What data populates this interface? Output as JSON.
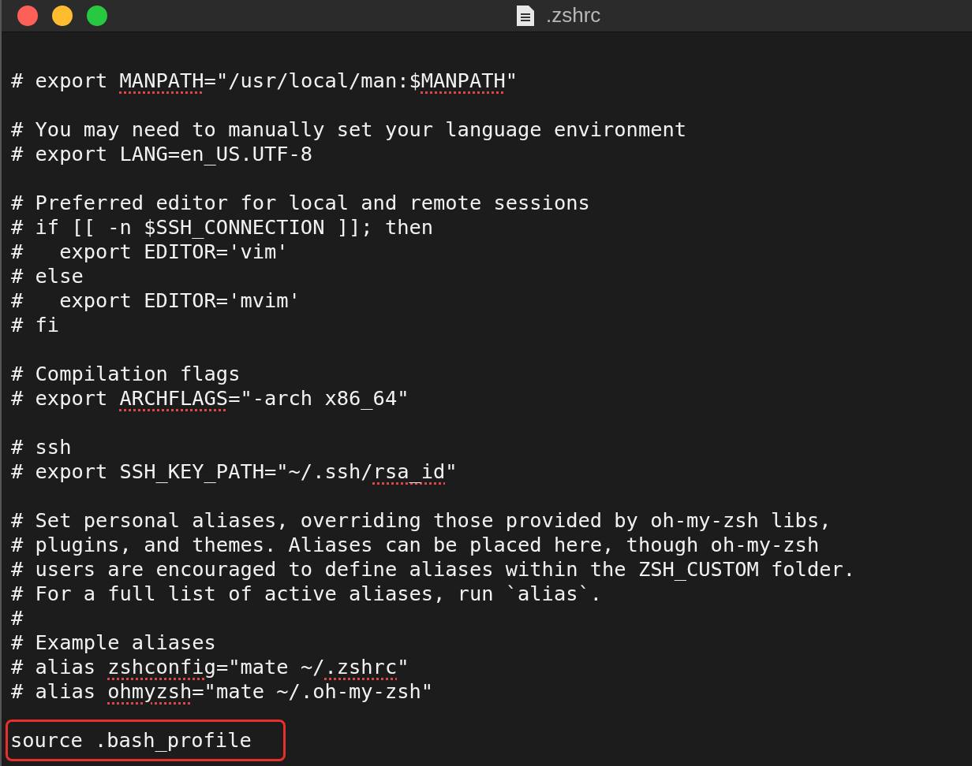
{
  "window": {
    "title": ".zshrc"
  },
  "lines": [
    {
      "kind": "blank"
    },
    {
      "kind": "text",
      "highlighted": false,
      "segments": [
        {
          "text": "# export ",
          "misspelled": false
        },
        {
          "text": "MANPATH",
          "misspelled": true
        },
        {
          "text": "=\"/usr/local/man:$",
          "misspelled": false
        },
        {
          "text": "MANPATH",
          "misspelled": true
        },
        {
          "text": "\"",
          "misspelled": false
        }
      ]
    },
    {
      "kind": "blank"
    },
    {
      "kind": "text",
      "highlighted": false,
      "segments": [
        {
          "text": "# You may need to manually set your language environment",
          "misspelled": false
        }
      ]
    },
    {
      "kind": "text",
      "highlighted": false,
      "segments": [
        {
          "text": "# export LANG=en_US.UTF-8",
          "misspelled": false
        }
      ]
    },
    {
      "kind": "blank"
    },
    {
      "kind": "text",
      "highlighted": false,
      "segments": [
        {
          "text": "# Preferred editor for local and remote sessions",
          "misspelled": false
        }
      ]
    },
    {
      "kind": "text",
      "highlighted": false,
      "segments": [
        {
          "text": "# if [[ -n $SSH_CONNECTION ]]; then",
          "misspelled": false
        }
      ]
    },
    {
      "kind": "text",
      "highlighted": false,
      "segments": [
        {
          "text": "#   export EDITOR='vim'",
          "misspelled": false
        }
      ]
    },
    {
      "kind": "text",
      "highlighted": false,
      "segments": [
        {
          "text": "# else",
          "misspelled": false
        }
      ]
    },
    {
      "kind": "text",
      "highlighted": false,
      "segments": [
        {
          "text": "#   export EDITOR='mvim'",
          "misspelled": false
        }
      ]
    },
    {
      "kind": "text",
      "highlighted": false,
      "segments": [
        {
          "text": "# fi",
          "misspelled": false
        }
      ]
    },
    {
      "kind": "blank"
    },
    {
      "kind": "text",
      "highlighted": false,
      "segments": [
        {
          "text": "# Compilation flags",
          "misspelled": false
        }
      ]
    },
    {
      "kind": "text",
      "highlighted": false,
      "segments": [
        {
          "text": "# export ",
          "misspelled": false
        },
        {
          "text": "ARCHFLAGS",
          "misspelled": true
        },
        {
          "text": "=\"-arch x86_64\"",
          "misspelled": false
        }
      ]
    },
    {
      "kind": "blank"
    },
    {
      "kind": "text",
      "highlighted": false,
      "segments": [
        {
          "text": "# ssh",
          "misspelled": false
        }
      ]
    },
    {
      "kind": "text",
      "highlighted": false,
      "segments": [
        {
          "text": "# export SSH_KEY_PATH=\"~/.ssh/",
          "misspelled": false
        },
        {
          "text": "rsa_id",
          "misspelled": true
        },
        {
          "text": "\"",
          "misspelled": false
        }
      ]
    },
    {
      "kind": "blank"
    },
    {
      "kind": "text",
      "highlighted": false,
      "segments": [
        {
          "text": "# Set personal aliases, overriding those provided by oh-my-zsh libs,",
          "misspelled": false
        }
      ]
    },
    {
      "kind": "text",
      "highlighted": false,
      "segments": [
        {
          "text": "# plugins, and themes. Aliases can be placed here, though oh-my-zsh",
          "misspelled": false
        }
      ]
    },
    {
      "kind": "text",
      "highlighted": false,
      "segments": [
        {
          "text": "# users are encouraged to define aliases within the ZSH_CUSTOM folder.",
          "misspelled": false
        }
      ]
    },
    {
      "kind": "text",
      "highlighted": false,
      "segments": [
        {
          "text": "# For a full list of active aliases, run `alias`.",
          "misspelled": false
        }
      ]
    },
    {
      "kind": "text",
      "highlighted": false,
      "segments": [
        {
          "text": "#",
          "misspelled": false
        }
      ]
    },
    {
      "kind": "text",
      "highlighted": false,
      "segments": [
        {
          "text": "# Example aliases",
          "misspelled": false
        }
      ]
    },
    {
      "kind": "text",
      "highlighted": false,
      "segments": [
        {
          "text": "# alias ",
          "misspelled": false
        },
        {
          "text": "zshconfig",
          "misspelled": true
        },
        {
          "text": "=\"mate ~/",
          "misspelled": false
        },
        {
          "text": ".zshrc",
          "misspelled": true
        },
        {
          "text": "\"",
          "misspelled": false
        }
      ]
    },
    {
      "kind": "text",
      "highlighted": false,
      "segments": [
        {
          "text": "# alias ",
          "misspelled": false
        },
        {
          "text": "ohmyzsh",
          "misspelled": true
        },
        {
          "text": "=\"mate ~/.oh-my-zsh\"",
          "misspelled": false
        }
      ]
    },
    {
      "kind": "blank"
    },
    {
      "kind": "text",
      "highlighted": true,
      "segments": [
        {
          "text": "source .bash_profile",
          "misspelled": false
        }
      ]
    }
  ]
}
